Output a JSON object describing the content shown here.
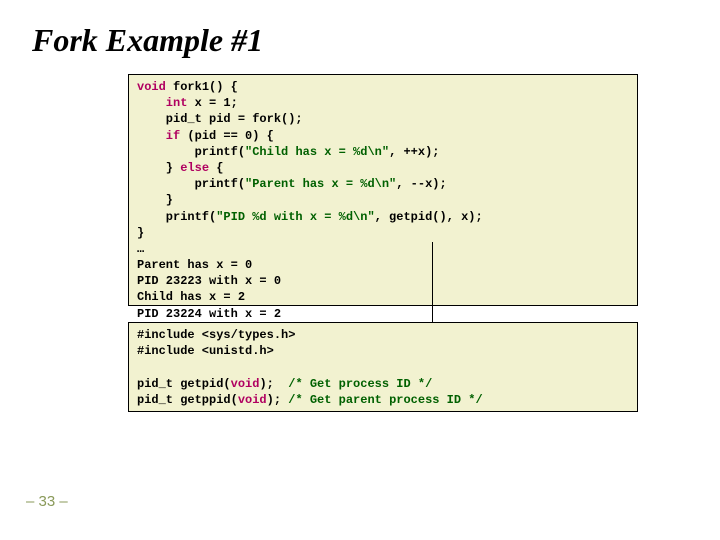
{
  "title": "Fork Example #1",
  "code1": {
    "l1a": "void",
    "l1b": " fork1() {",
    "l2a": "    int",
    "l2b": " x = 1;",
    "l3": "    pid_t pid = fork();",
    "l4a": "    if",
    "l4b": " (pid == 0) {",
    "l5a": "        printf(",
    "l5b": "\"Child has x = %d\\n\"",
    "l5c": ", ++x);",
    "l6a": "    } ",
    "l6b": "else",
    "l6c": " {",
    "l7a": "        printf(",
    "l7b": "\"Parent has x = %d\\n\"",
    "l7c": ", --x);",
    "l8": "    }",
    "l9a": "    printf(",
    "l9b": "\"PID %d with x = %d\\n\"",
    "l9c": ", getpid(), x);",
    "l10": "}",
    "l11": "…",
    "l12": "Parent has x = 0",
    "l13": "PID 23223 with x = 0",
    "l14": "Child has x = 2",
    "l15": "PID 23224 with x = 2"
  },
  "code2": {
    "l1": "#include <sys/types.h>",
    "l2": "#include <unistd.h>",
    "blank": "",
    "l3a": "pid_t getpid(",
    "l3b": "void",
    "l3c": ");  ",
    "l3d": "/* Get process ID */",
    "l4a": "pid_t getppid(",
    "l4b": "void",
    "l4c": "); ",
    "l4d": "/* Get parent process ID */"
  },
  "pagenum": "– 33 –"
}
